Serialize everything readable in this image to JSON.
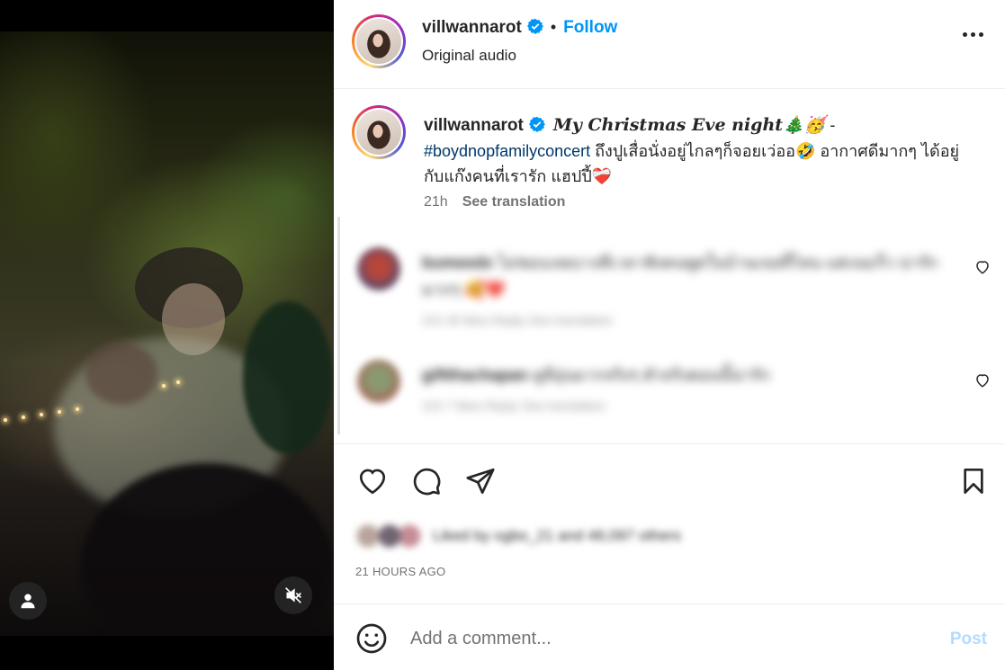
{
  "header": {
    "username": "villwannarot",
    "separator": "•",
    "follow_label": "Follow",
    "audio_label": "Original audio",
    "more_icon": "more-horizontal-icon"
  },
  "caption": {
    "username": "villwannarot",
    "title": "My Christmas Eve night🎄🥳",
    "dash": " -",
    "hashtag": "#boydnopfamilyconcert",
    "text": " ถึงปูเสื่อนั่งอยู่ไกลๆก็จอยเว่ออ🤣 อากาศดีมากๆ ได้อยู่กับแก๊งคนที่เรารัก แฮปปี้❤️‍🩹",
    "time": "21h",
    "see_translation": "See translation"
  },
  "comments": [
    {
      "username": "bumeedx",
      "text": "ไม่ชอบเลยบางทีเวลาฟังคนพูดในบ้านเจอที่ไหน แต่เจอเร็ว น่ารักมากๆ 🥰❤️",
      "sub": "21h   35 likes   Reply   See translation"
    },
    {
      "username": "giftthachapan",
      "text": "ดูดีอุ่นมากจริงๆ ตัวจริงตอนนี้น่ารัก",
      "sub": "21h   7 likes   Reply   See translation"
    }
  ],
  "likes": {
    "text": "Liked by ogbo_21 and 48,097 others"
  },
  "timestamp": "21 HOURS AGO",
  "comment_box": {
    "placeholder": "Add a comment...",
    "post_label": "Post"
  },
  "colors": {
    "accent": "#0095f6",
    "post_disabled": "#b3dbff",
    "hashtag": "#00376b",
    "muted": "#737373"
  }
}
